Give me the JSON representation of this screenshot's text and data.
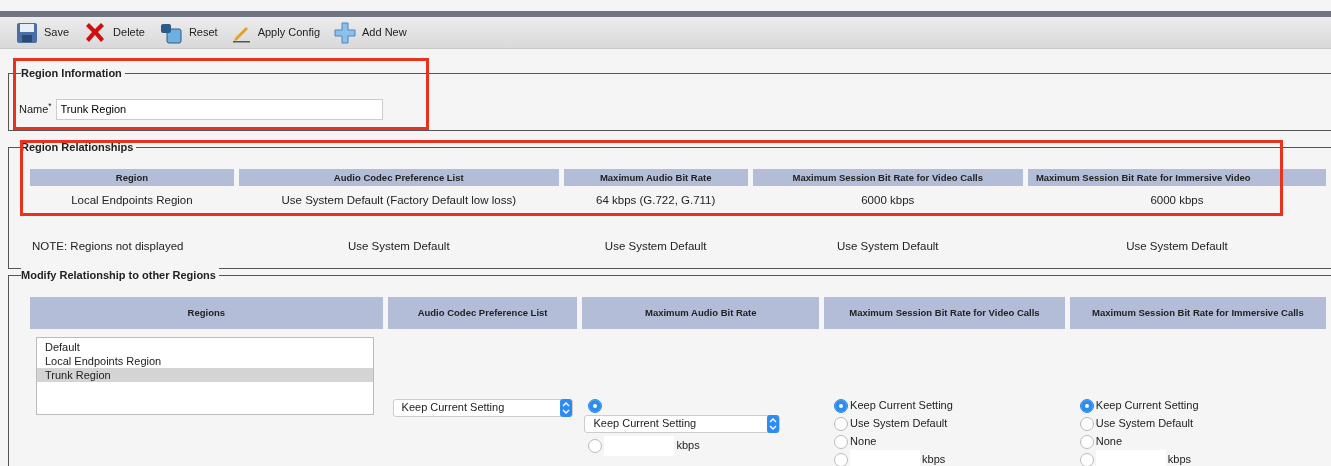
{
  "toolbar": [
    {
      "kind": "save",
      "label": "Save"
    },
    {
      "kind": "delete",
      "label": "Delete"
    },
    {
      "kind": "reset",
      "label": "Reset"
    },
    {
      "kind": "apply",
      "label": "Apply Config"
    },
    {
      "kind": "add",
      "label": "Add New"
    }
  ],
  "region_information": {
    "legend": "Region Information",
    "name_label": "Name$^{*}$",
    "name_value": "Trunk Region"
  },
  "region_relationships": {
    "legend": "Region Relationships",
    "columns": [
      "Region",
      "Audio Codec Preference List",
      "Maximum Audio Bit Rate",
      "Maximum Session Bit Rate for Video Calls",
      "Maximum Session Bit Rate for Immersive Video"
    ],
    "rows": [
      [
        "Local Endpoints Region",
        "Use System Default (Factory Default low loss)",
        "64 kbps (G.722, G.711)",
        "6000 kbps",
        "6000 kbps"
      ]
    ],
    "note_row": [
      "NOTE: Regions not displayed",
      "Use System Default",
      "Use System Default",
      "Use System Default",
      "Use System Default"
    ]
  },
  "modify_relationship": {
    "legend": "Modify Relationship to other Regions",
    "columns": [
      "Regions",
      "Audio Codec Preference List",
      "Maximum Audio Bit Rate",
      "Maximum Session Bit Rate for Video Calls",
      "Maximum Session Bit Rate for Immersive Calls"
    ],
    "regions": [
      {
        "label": "Default",
        "selected": false
      },
      {
        "label": "Local Endpoints Region",
        "selected": false
      },
      {
        "label": "Trunk Region",
        "selected": true
      }
    ],
    "audio_codec": {
      "value": "Keep Current Setting"
    },
    "max_audio": [
      {
        "kind": "select",
        "selected": true,
        "value": "Keep Current Setting"
      },
      {
        "kind": "kbps",
        "selected": false,
        "unit": "kbps"
      }
    ],
    "video": [
      {
        "kind": "label",
        "selected": true,
        "label": "Keep Current Setting"
      },
      {
        "kind": "label",
        "selected": false,
        "label": "Use System Default"
      },
      {
        "kind": "label",
        "selected": false,
        "label": "None"
      },
      {
        "kind": "kbps",
        "selected": false,
        "unit": "kbps"
      }
    ],
    "immersive": [
      {
        "kind": "label",
        "selected": true,
        "label": "Keep Current Setting"
      },
      {
        "kind": "label",
        "selected": false,
        "label": "Use System Default"
      },
      {
        "kind": "label",
        "selected": false,
        "label": "None"
      },
      {
        "kind": "kbps",
        "selected": false,
        "unit": "kbps"
      }
    ]
  }
}
